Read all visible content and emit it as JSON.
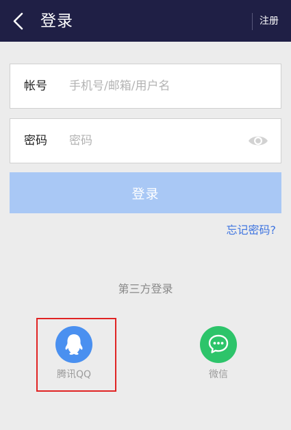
{
  "header": {
    "title": "登录",
    "register_label": "注册",
    "back_icon": "chevron-left-icon"
  },
  "form": {
    "account": {
      "label": "帐号",
      "placeholder": "手机号/邮箱/用户名",
      "value": ""
    },
    "password": {
      "label": "密码",
      "placeholder": "密码",
      "value": "",
      "toggle_icon": "eye-icon"
    },
    "login_button": "登录",
    "forgot_link": "忘记密码?"
  },
  "third_party": {
    "title": "第三方登录",
    "providers": [
      {
        "id": "qq",
        "label": "腾讯QQ",
        "icon": "qq-icon",
        "color": "#4a90f0"
      },
      {
        "id": "wechat",
        "label": "微信",
        "icon": "wechat-icon",
        "color": "#2dc46a"
      }
    ]
  },
  "colors": {
    "header_bg": "#1f1f45",
    "page_bg": "#ececec",
    "login_button_bg": "#a9c8f5",
    "link": "#3d73e0",
    "highlight_border": "#e02222"
  }
}
